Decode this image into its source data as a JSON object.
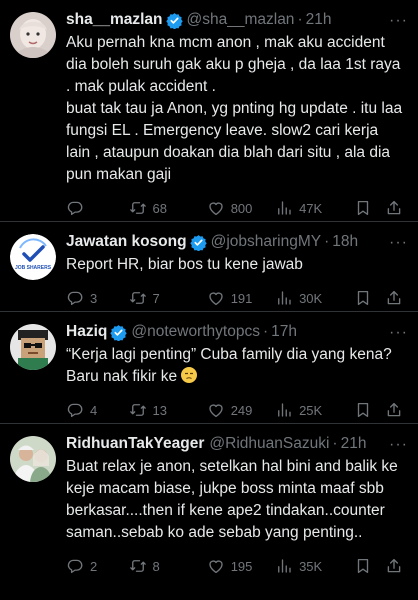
{
  "tweets": [
    {
      "name": "sha__mazlan",
      "handle": "@sha__mazlan",
      "time": "21h",
      "body": "Aku pernah kna mcm anon , mak aku accident dia boleh suruh gak aku p gheja , da laa 1st raya . mak pulak accident .\nbuat tak tau ja Anon, yg pnting hg update . itu laa fungsi EL . Emergency leave. slow2 cari kerja lain , ataupun doakan dia blah dari situ , ala dia pun makan gaji",
      "replies": "",
      "retweets": "68",
      "likes": "800",
      "views": "47K"
    },
    {
      "name": "Jawatan kosong",
      "handle": "@jobsharingMY",
      "time": "18h",
      "avatar_text": "JOB SHARERS",
      "body": "Report HR, biar bos tu kene jawab",
      "replies": "3",
      "retweets": "7",
      "likes": "191",
      "views": "30K"
    },
    {
      "name": "Haziq",
      "handle": "@noteworthytopcs",
      "time": "17h",
      "body": "“Kerja lagi penting” Cuba family dia yang kena? Baru nak fikir ke",
      "replies": "4",
      "retweets": "13",
      "likes": "249",
      "views": "25K"
    },
    {
      "name": "RidhuanTakYeager",
      "handle": "@RidhuanSazuki",
      "time": "21h",
      "body": "Buat relax  je anon, setelkan hal bini and balik ke keje macam biase, jukpe boss minta maaf sbb berkasar....then if kene ape2 tindakan..counter saman..sebab ko ade sebab yang penting..",
      "replies": "2",
      "retweets": "8",
      "likes": "195",
      "views": "35K"
    }
  ],
  "colors": {
    "background": "#000000",
    "text": "#e7e9ea",
    "muted": "#71767b",
    "verified": "#1d9bf0",
    "divider": "#2f3336"
  },
  "icons": [
    "verified-badge-icon",
    "reply-icon",
    "retweet-icon",
    "like-icon",
    "views-icon",
    "bookmark-icon",
    "share-icon",
    "more-icon"
  ]
}
